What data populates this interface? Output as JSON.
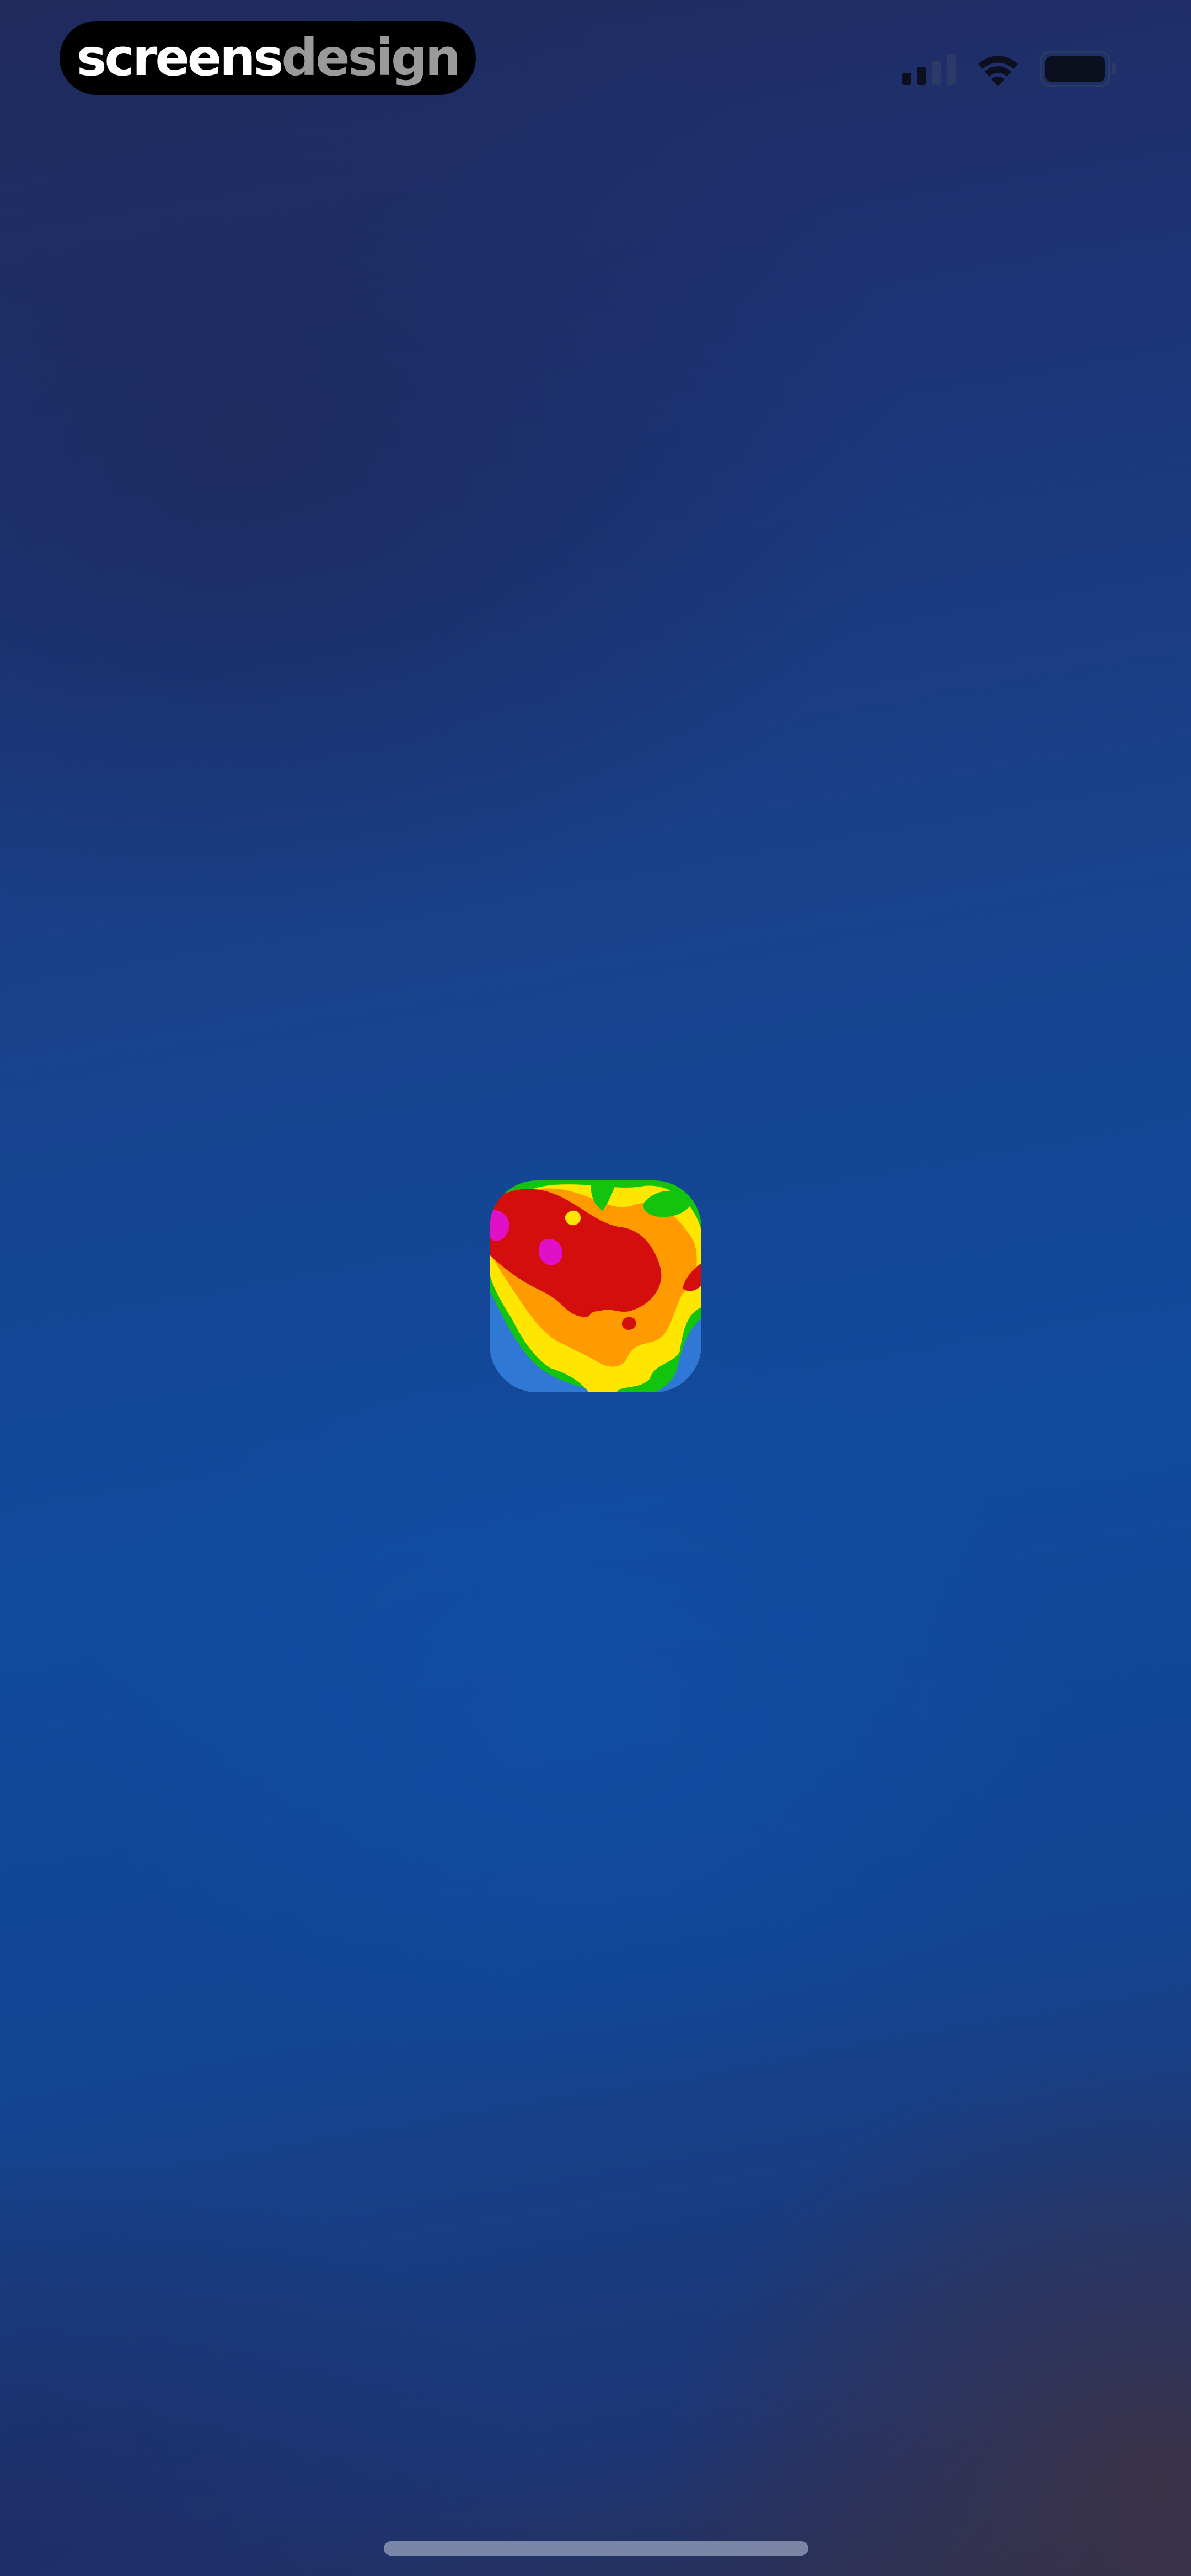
{
  "status_bar": {
    "brand": {
      "part_a": "screens",
      "part_b": "design"
    },
    "signal_icon": "cellular-signal-icon",
    "wifi_icon": "wifi-icon",
    "battery_icon": "battery-icon"
  },
  "splash": {
    "app_icon": "weather-radar-app-icon"
  },
  "colors": {
    "background_top": "#202a5c",
    "background_mid": "#114a9c",
    "background_bottom": "#2b2f52",
    "radar_red": "#d40d0d",
    "radar_orange": "#ff9a00",
    "radar_yellow": "#ffe600",
    "radar_green": "#12c40e",
    "radar_magenta": "#e010c8",
    "radar_blue": "#2f78d6"
  }
}
